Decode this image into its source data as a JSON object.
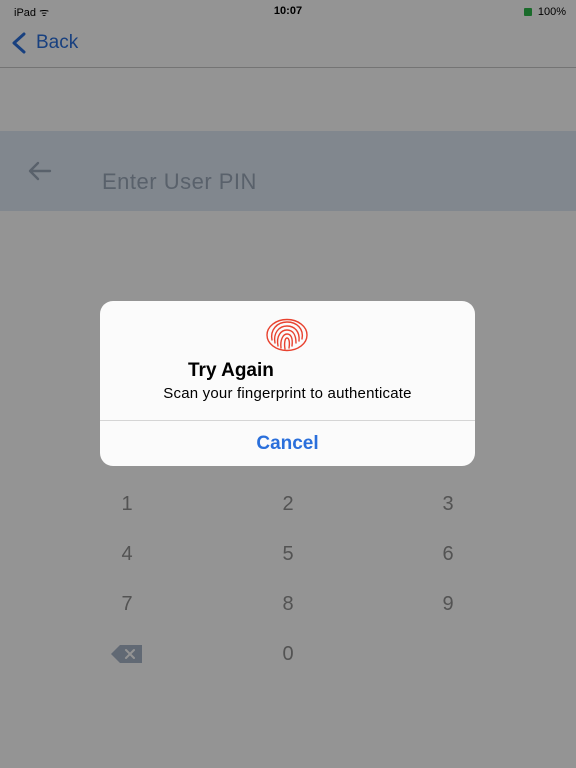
{
  "status_bar": {
    "carrier": "iPad ᯤ",
    "time": "10:07",
    "battery": "100%"
  },
  "nav": {
    "back_label": "Back"
  },
  "pin_screen": {
    "title": "Enter User PIN"
  },
  "keypad": {
    "keys": [
      "1",
      "2",
      "3",
      "4",
      "5",
      "6",
      "7",
      "8",
      "9",
      "0"
    ]
  },
  "alert": {
    "icon": "fingerprint-icon",
    "title": "Try Again",
    "message": "Scan your fingerprint to authenticate",
    "cancel_label": "Cancel"
  },
  "colors": {
    "accent": "#2a6fdb",
    "fingerprint": "#e8422f",
    "pin_header": "#dfe9f5"
  }
}
